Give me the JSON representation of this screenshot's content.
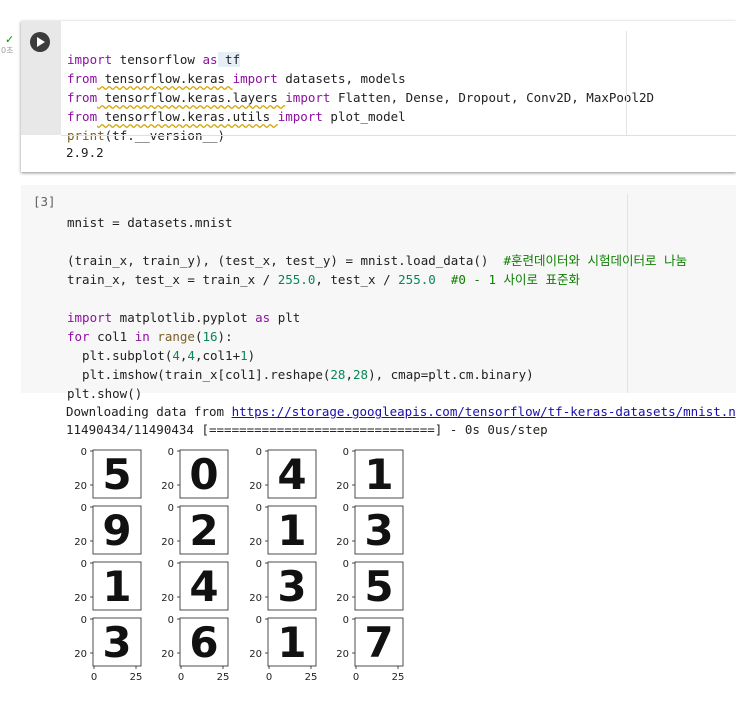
{
  "cell1": {
    "status_check": "✓",
    "exec_time": "0초",
    "code_lines": [
      [
        "import",
        " tensorflow ",
        "as",
        " tf"
      ],
      [
        "from",
        " tensorflow.keras ",
        "import",
        " datasets, models"
      ],
      [
        "from",
        " tensorflow.keras.layers ",
        "import",
        " Flatten, Dense, Dropout, Conv2D, MaxPool2D"
      ],
      [
        "from",
        " tensorflow.keras.utils ",
        "import",
        " plot_model"
      ],
      [
        "print",
        "(tf.__version__)"
      ]
    ],
    "output": "2.9.2"
  },
  "cell2": {
    "exec_count": "[3]",
    "line1": "mnist = datasets.mnist",
    "line3a": "(train_x, train_y), (test_x, test_y) = mnist.load_data()  ",
    "line3c": "#훈련데이터와 시험데이터로 나눔",
    "line4a": "train_x, test_x = train_x / ",
    "line4n1": "255.0",
    "line4b": ", test_x / ",
    "line4n2": "255.0",
    "line4c": "  #0 - 1 사이로 표준화",
    "line6k1": "import",
    "line6a": " matplotlib.pyplot ",
    "line6k2": "as",
    "line6b": " plt",
    "line7k1": "for",
    "line7a": " col1 ",
    "line7k2": "in",
    "line7f": " range",
    "line7b": "(",
    "line7n": "16",
    "line7c": "):",
    "line8a": "  plt.subplot(",
    "line8n1": "4",
    "line8s1": ",",
    "line8n2": "4",
    "line8s2": ",col1+",
    "line8n3": "1",
    "line8e": ")",
    "line9a": "  plt.imshow(train_x[col1].reshape(",
    "line9n1": "28",
    "line9s": ",",
    "line9n2": "28",
    "line9e": "), cmap=plt.cm.binary)",
    "line10": "plt.show()",
    "download_prefix": "Downloading data from ",
    "download_url": "https://storage.googleapis.com/tensorflow/tf-keras-datasets/mnist.npz",
    "progress_line": "11490434/11490434 [==============================] - 0s 0us/step"
  },
  "chart_data": {
    "type": "image-grid",
    "rows": 4,
    "cols": 4,
    "digits": [
      5,
      0,
      4,
      1,
      9,
      2,
      1,
      3,
      1,
      4,
      3,
      5,
      3,
      6,
      1,
      7
    ],
    "x_ticks": [
      "0",
      "25"
    ],
    "y_ticks": [
      "0",
      "20"
    ],
    "cmap": "binary"
  }
}
